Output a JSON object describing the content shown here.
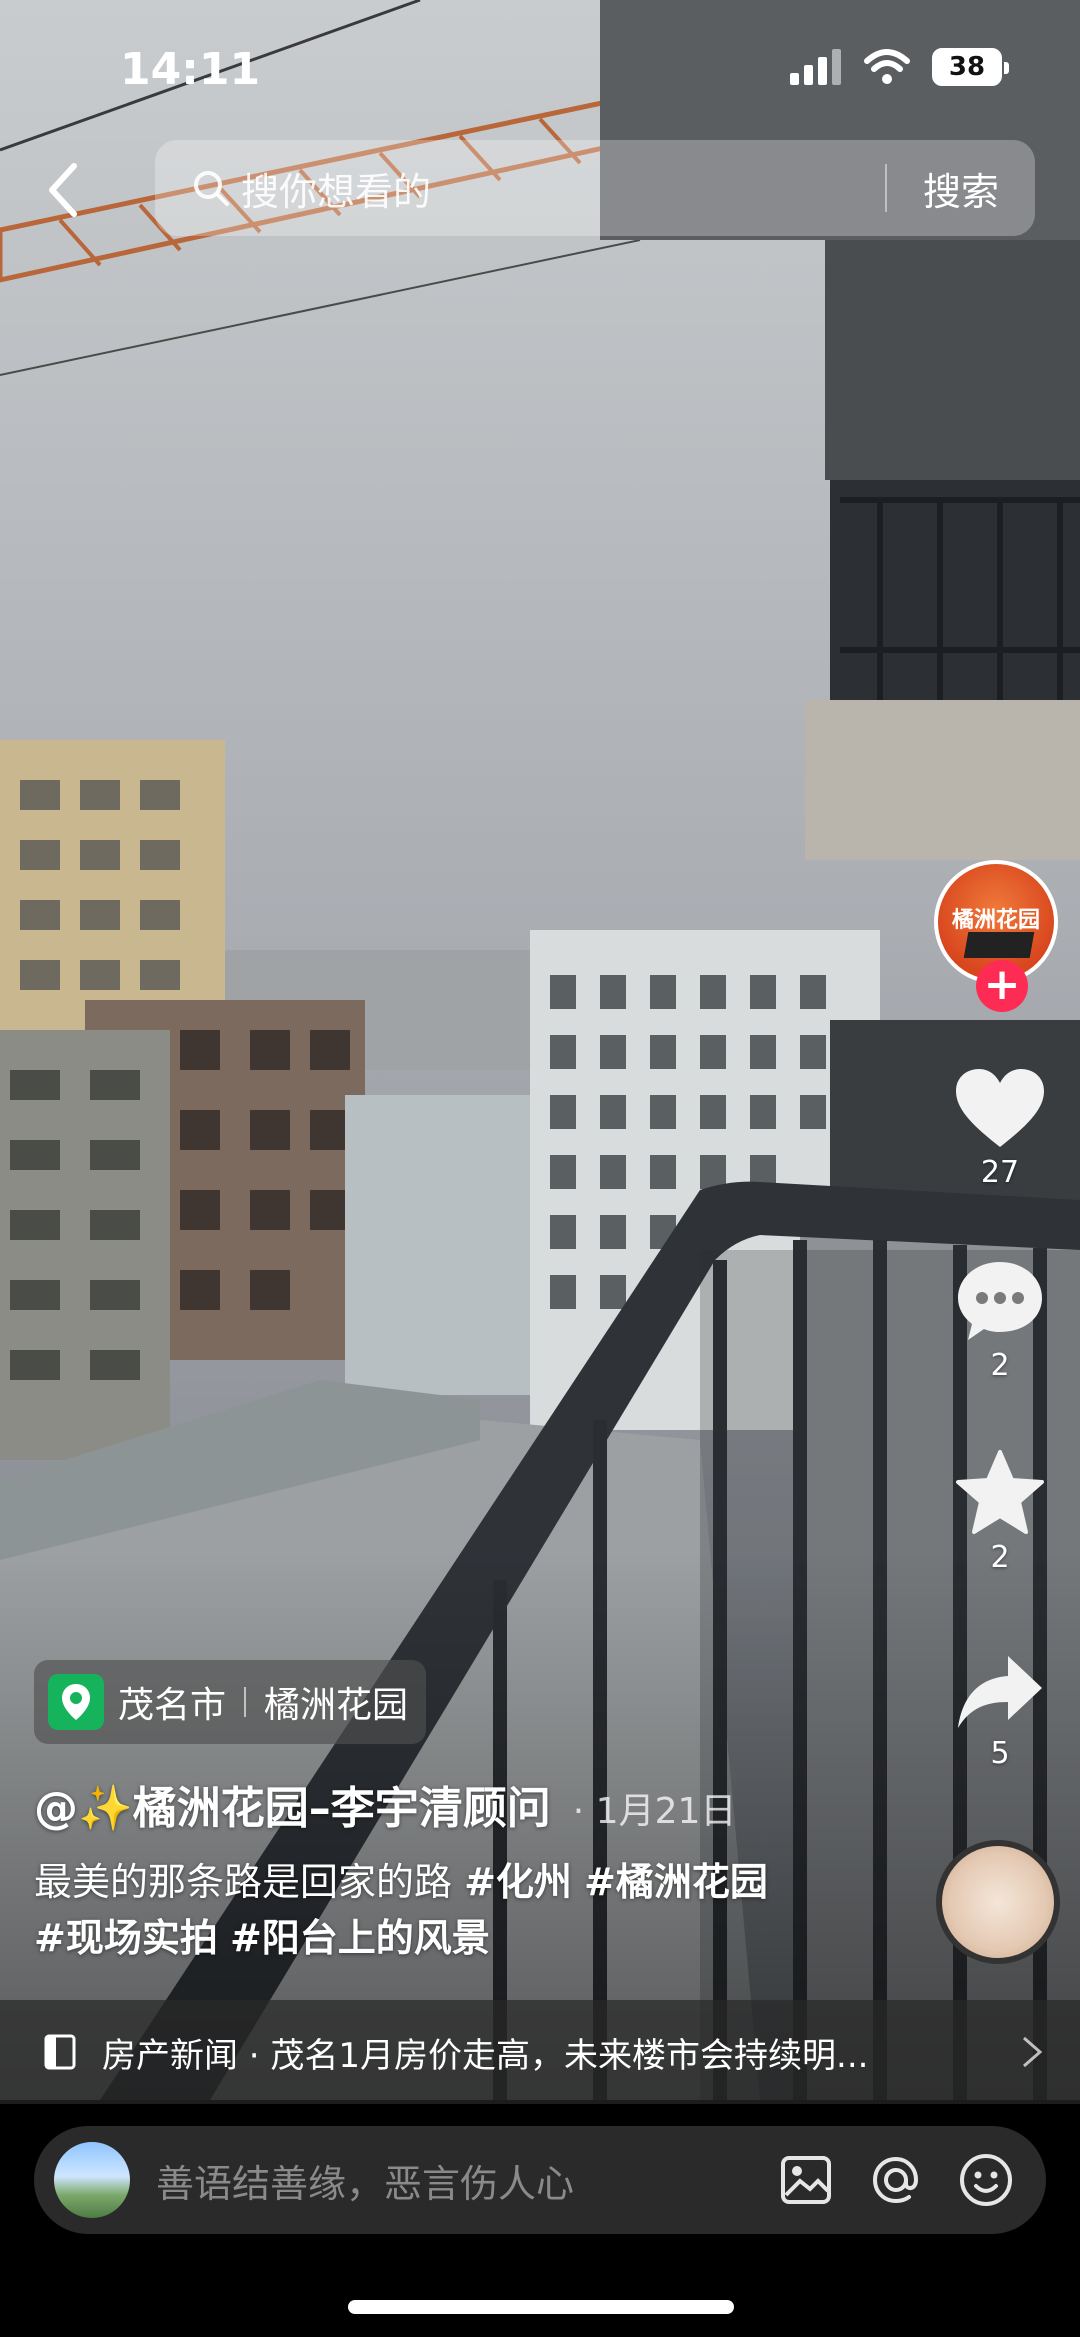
{
  "status_bar": {
    "time": "14:11",
    "battery": "38"
  },
  "search": {
    "placeholder": "搜你想看的",
    "button": "搜索"
  },
  "creator": {
    "avatar_text": "橘洲花园"
  },
  "actions": {
    "likes": "27",
    "comments": "2",
    "favorites": "2",
    "shares": "5"
  },
  "location": {
    "city": "茂名市",
    "place": "橘洲花园"
  },
  "post": {
    "author": "@✨橘洲花园–李宇清顾问",
    "date": "· 1月21日",
    "caption_text": "最美的那条路是回家的路 ",
    "tags": [
      "#化州",
      "#橘洲花园",
      "#现场实拍",
      "#阳台上的风景"
    ]
  },
  "news": {
    "text": "房产新闻 · 茂名1月房价走高，未来楼市会持续明..."
  },
  "comment_bar": {
    "placeholder": "善语结善缘，恶言伤人心"
  },
  "icons": {
    "back": "chevron-left-icon",
    "search": "search-icon",
    "like": "heart-icon",
    "comment": "comment-bubble-icon",
    "favorite": "star-icon",
    "share": "share-arrow-icon",
    "location": "location-pin-icon",
    "news": "book-icon",
    "image": "image-icon",
    "mention": "at-icon",
    "emoji": "emoji-icon"
  },
  "colors": {
    "accent": "#fe2c55",
    "location_green": "#16b35d"
  }
}
